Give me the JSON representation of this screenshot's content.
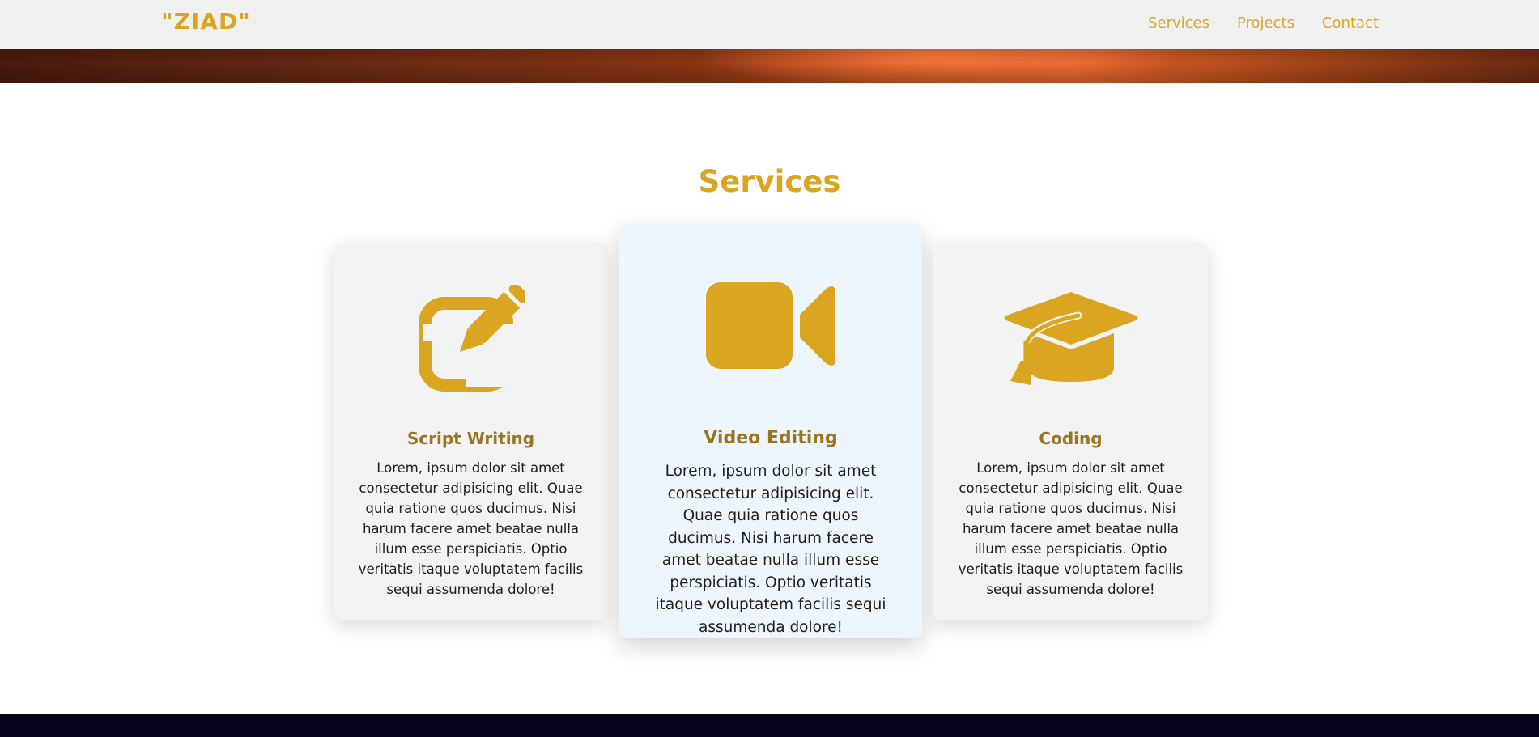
{
  "header": {
    "logo": "\"ZIAD\"",
    "nav": [
      "Services",
      "Projects",
      "Contact"
    ]
  },
  "services": {
    "title": "Services",
    "cards": [
      {
        "icon": "pen-to-square-icon",
        "title": "Script Writing",
        "body": "Lorem, ipsum dolor sit amet consectetur adipisicing elit. Quae quia ratione quos ducimus. Nisi harum facere amet beatae nulla illum esse perspiciatis. Optio veritatis itaque voluptatem facilis sequi assumenda dolore!"
      },
      {
        "icon": "video-camera-icon",
        "title": "Video Editing",
        "body": "Lorem, ipsum dolor sit amet consectetur adipisicing elit. Quae quia ratione quos ducimus. Nisi harum facere amet beatae nulla illum esse perspiciatis. Optio veritatis itaque voluptatem facilis sequi assumenda dolore!"
      },
      {
        "icon": "graduation-cap-icon",
        "title": "Coding",
        "body": "Lorem, ipsum dolor sit amet consectetur adipisicing elit. Quae quia ratione quos ducimus. Nisi harum facere amet beatae nulla illum esse perspiciatis. Optio veritatis itaque voluptatem facilis sequi assumenda dolore!"
      }
    ]
  },
  "colors": {
    "accent": "#daa520",
    "card_title": "#9a7420",
    "nav_bg": "#f0f0f0",
    "footer_bg": "#04031a"
  }
}
